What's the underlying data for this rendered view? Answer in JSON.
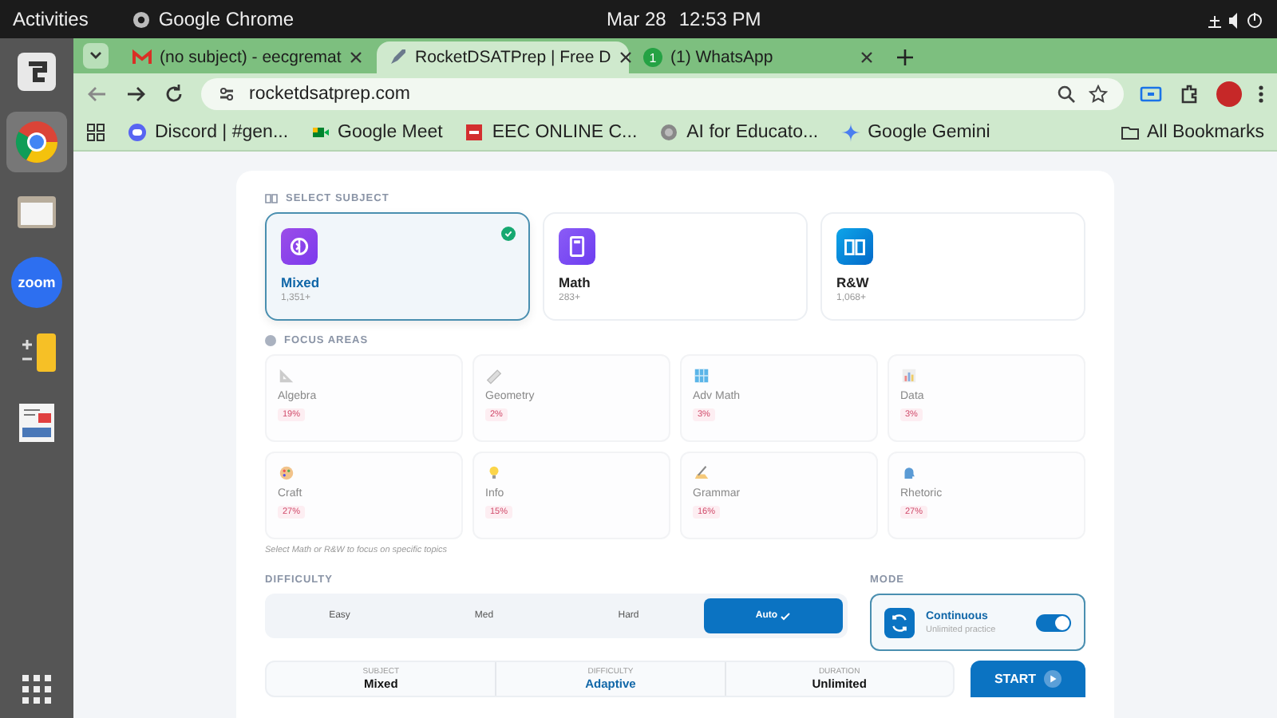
{
  "system_bar": {
    "activities": "Activities",
    "app": "Google Chrome",
    "date": "Mar 28",
    "time": "12:53 PM"
  },
  "dock": [
    {
      "kind": "notes"
    },
    {
      "kind": "chrome",
      "selected": true
    },
    {
      "kind": "files"
    },
    {
      "kind": "zoom",
      "label": "zoom"
    },
    {
      "kind": "calculator"
    },
    {
      "kind": "document"
    }
  ],
  "tabs": [
    {
      "title": "(no subject) - eecgremat",
      "selected": false
    },
    {
      "title": "RocketDSATPrep | Free D",
      "selected": true
    },
    {
      "title": "(1) WhatsApp",
      "badge": "1",
      "selected": false
    }
  ],
  "address": "rocketdsatprep.com",
  "bookmarks": [
    {
      "title": "Discord | #gen..."
    },
    {
      "title": "Google Meet"
    },
    {
      "title": "EEC ONLINE C..."
    },
    {
      "title": "AI for Educato..."
    },
    {
      "title": "Google Gemini"
    }
  ],
  "all_bookmarks": "All Bookmarks",
  "subject_section": {
    "label": "SELECT SUBJECT",
    "subjects": [
      {
        "name": "Mixed",
        "count": "1,351+",
        "selected": true
      },
      {
        "name": "Math",
        "count": "283+",
        "selected": false
      },
      {
        "name": "R&W",
        "count": "1,068+",
        "selected": false
      }
    ]
  },
  "focus_section": {
    "label": "FOCUS AREAS",
    "areas": [
      {
        "name": "Algebra",
        "percent": "19%"
      },
      {
        "name": "Geometry",
        "percent": "2%"
      },
      {
        "name": "Adv Math",
        "percent": "3%"
      },
      {
        "name": "Data",
        "percent": "3%"
      },
      {
        "name": "Craft",
        "percent": "27%"
      },
      {
        "name": "Info",
        "percent": "15%"
      },
      {
        "name": "Grammar",
        "percent": "16%"
      },
      {
        "name": "Rhetoric",
        "percent": "27%"
      }
    ],
    "hint": "Select Math or R&W to focus on specific topics"
  },
  "difficulty": {
    "label": "DIFFICULTY",
    "options": [
      {
        "label": "Easy",
        "selected": false
      },
      {
        "label": "Med",
        "selected": false
      },
      {
        "label": "Hard",
        "selected": false
      },
      {
        "label": "Auto",
        "selected": true
      }
    ]
  },
  "mode": {
    "label": "MODE",
    "title": "Continuous",
    "subtitle": "Unlimited practice",
    "on": true
  },
  "summary": [
    {
      "label": "SUBJECT",
      "value": "Mixed",
      "highlighted": false
    },
    {
      "label": "DIFFICULTY",
      "value": "Adaptive",
      "highlighted": true
    },
    {
      "label": "DURATION",
      "value": "Unlimited",
      "highlighted": false
    }
  ],
  "start": "START"
}
